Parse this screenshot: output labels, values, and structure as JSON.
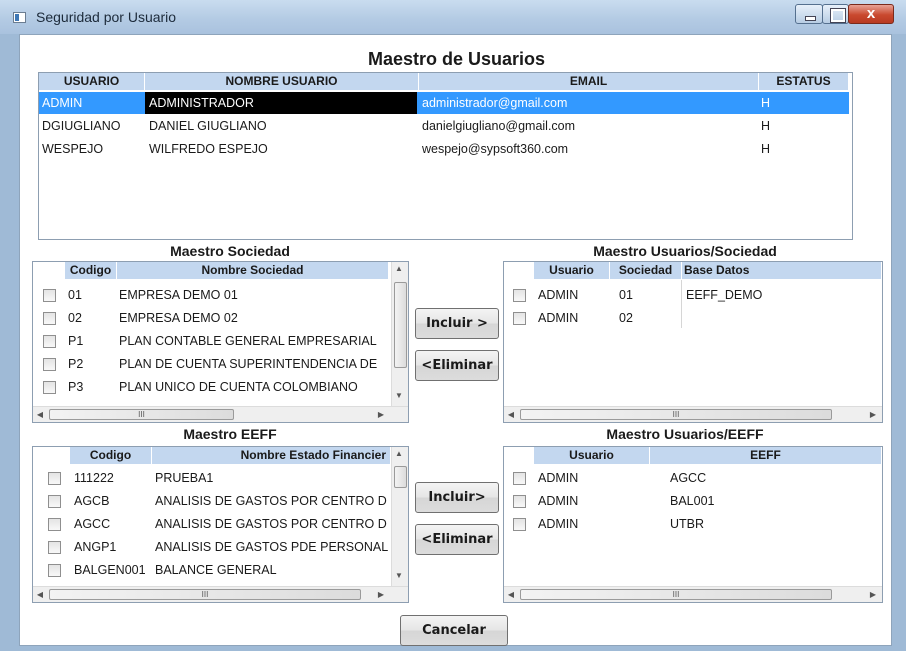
{
  "window": {
    "title": "Seguridad por Usuario",
    "close_glyph": "x",
    "icons": [
      "app-icon",
      "minimize-icon",
      "maximize-icon",
      "close-icon"
    ]
  },
  "usuarios": {
    "heading": "Maestro de Usuarios",
    "columns": [
      "USUARIO",
      "NOMBRE USUARIO",
      "EMAIL",
      "ESTATUS"
    ],
    "rows": [
      {
        "usuario": "ADMIN",
        "nombre": "ADMINISTRADOR",
        "email": "administrador@gmail.com",
        "estatus": "H"
      },
      {
        "usuario": "DGIUGLIANO",
        "nombre": "DANIEL GIUGLIANO",
        "email": "danielgiugliano@gmail.com",
        "estatus": "H"
      },
      {
        "usuario": "WESPEJO",
        "nombre": "WILFREDO ESPEJO",
        "email": "wespejo@sypsoft360.com",
        "estatus": "H"
      }
    ],
    "selected_row": 0
  },
  "sociedad": {
    "heading": "Maestro Sociedad",
    "columns": [
      "Codigo",
      "Nombre Sociedad"
    ],
    "rows": [
      {
        "codigo": "01",
        "nombre": "EMPRESA DEMO 01"
      },
      {
        "codigo": "02",
        "nombre": "EMPRESA DEMO 02"
      },
      {
        "codigo": "P1",
        "nombre": "PLAN CONTABLE GENERAL EMPRESARIAL"
      },
      {
        "codigo": "P2",
        "nombre": "PLAN DE CUENTA SUPERINTENDENCIA DE"
      },
      {
        "codigo": "P3",
        "nombre": "PLAN UNICO DE CUENTA COLOMBIANO"
      }
    ],
    "hscroll_glyph": "III"
  },
  "usuarios_sociedad": {
    "heading": "Maestro Usuarios/Sociedad",
    "columns": [
      "Usuario",
      "Sociedad",
      "Base Datos"
    ],
    "rows": [
      {
        "usuario": "ADMIN",
        "sociedad": "01",
        "base": "EEFF_DEMO"
      },
      {
        "usuario": "ADMIN",
        "sociedad": "02",
        "base": ""
      }
    ],
    "hscroll_glyph": "III"
  },
  "eeff": {
    "heading": "Maestro EEFF",
    "columns": [
      "Codigo",
      "Nombre Estado Financier"
    ],
    "rows": [
      {
        "codigo": "111222",
        "nombre": "PRUEBA1"
      },
      {
        "codigo": "AGCB",
        "nombre": "ANALISIS DE GASTOS POR CENTRO D"
      },
      {
        "codigo": "AGCC",
        "nombre": "ANALISIS DE GASTOS POR CENTRO D"
      },
      {
        "codigo": "ANGP1",
        "nombre": "ANALISIS DE GASTOS PDE PERSONAL"
      },
      {
        "codigo": "BALGEN001",
        "nombre": "BALANCE GENERAL"
      }
    ],
    "hscroll_glyph": "III"
  },
  "usuarios_eeff": {
    "heading": "Maestro Usuarios/EEFF",
    "columns": [
      "Usuario",
      "EEFF"
    ],
    "rows": [
      {
        "usuario": "ADMIN",
        "eeff": "AGCC"
      },
      {
        "usuario": "ADMIN",
        "eeff": "BAL001"
      },
      {
        "usuario": "ADMIN",
        "eeff": "UTBR"
      }
    ],
    "hscroll_glyph": "III"
  },
  "buttons": {
    "incluir_sociedad": "Incluir >",
    "eliminar_sociedad": "<Eliminar",
    "incluir_eeff": "Incluir>",
    "eliminar_eeff": "<Eliminar",
    "cancelar": "Cancelar"
  }
}
